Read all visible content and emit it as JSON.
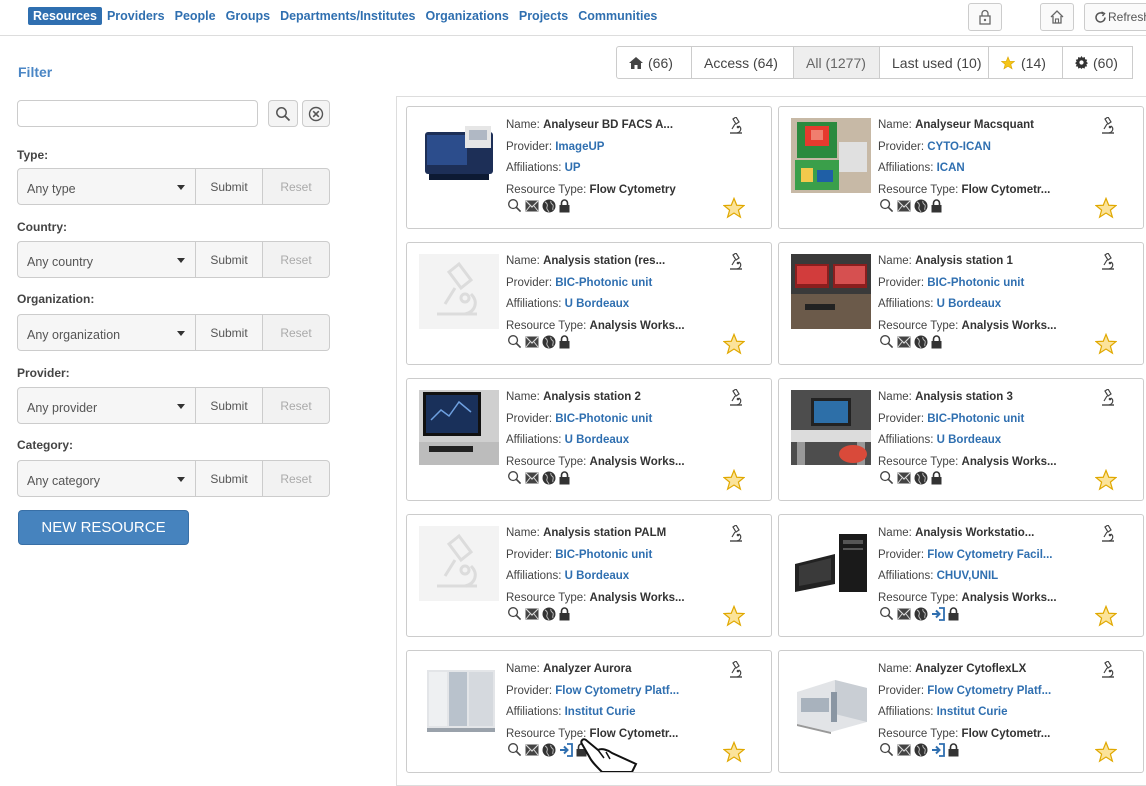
{
  "nav": {
    "links": [
      "Resources",
      "Providers",
      "People",
      "Groups",
      "Departments/Institutes",
      "Organizations",
      "Projects",
      "Communities"
    ],
    "refresh_label": "Refresh"
  },
  "tabs": [
    {
      "label": "(66)",
      "icon": "home-icon"
    },
    {
      "label": "Access (64)"
    },
    {
      "label": "All (1277)"
    },
    {
      "label": "Last used (10)"
    },
    {
      "label": "(14)",
      "icon": "star-icon"
    },
    {
      "label": "(60)",
      "icon": "gear-icon"
    }
  ],
  "filter": {
    "title": "Filter",
    "search_value": "",
    "submit_label": "Submit",
    "reset_label": "Reset",
    "groups": [
      {
        "label": "Type:",
        "value": "Any type"
      },
      {
        "label": "Country:",
        "value": "Any country"
      },
      {
        "label": "Organization:",
        "value": "Any organization"
      },
      {
        "label": "Provider:",
        "value": "Any provider"
      },
      {
        "label": "Category:",
        "value": "Any category"
      }
    ],
    "new_resource_label": "NEW RESOURCE"
  },
  "field_labels": {
    "name": "Name:",
    "provider": "Provider:",
    "affiliations": "Affiliations:",
    "type": "Resource Type:"
  },
  "resources": [
    {
      "name": "Analyseur BD FACS A...",
      "provider": "ImageUP",
      "affiliations": "UP",
      "type": "Flow Cytometry",
      "thumb": "cytometer-dark",
      "login": false
    },
    {
      "name": "Analyseur Macsquant",
      "provider": "CYTO-ICAN",
      "affiliations": "ICAN",
      "type": "Flow Cytometr...",
      "thumb": "lab-machine-green",
      "login": false
    },
    {
      "name": "Analysis station (res...",
      "provider": "BIC-Photonic unit",
      "affiliations": "U Bordeaux",
      "type": "Analysis Works...",
      "thumb": "placeholder-microscope",
      "login": false
    },
    {
      "name": "Analysis station 1",
      "provider": "BIC-Photonic unit",
      "affiliations": "U Bordeaux",
      "type": "Analysis Works...",
      "thumb": "workstation-red",
      "login": false
    },
    {
      "name": "Analysis station 2",
      "provider": "BIC-Photonic unit",
      "affiliations": "U Bordeaux",
      "type": "Analysis Works...",
      "thumb": "workstation-blue",
      "login": false
    },
    {
      "name": "Analysis station 3",
      "provider": "BIC-Photonic unit",
      "affiliations": "U Bordeaux",
      "type": "Analysis Works...",
      "thumb": "workstation-desk",
      "login": false
    },
    {
      "name": "Analysis station PALM",
      "provider": "BIC-Photonic unit",
      "affiliations": "U Bordeaux",
      "type": "Analysis Works...",
      "thumb": "placeholder-microscope",
      "login": false
    },
    {
      "name": "Analysis Workstatio...",
      "provider": "Flow Cytometry Facil...",
      "affiliations": "CHUV,UNIL",
      "type": "Analysis Works...",
      "thumb": "pc-tower",
      "login": true
    },
    {
      "name": "Analyzer Aurora",
      "provider": "Flow Cytometry Platf...",
      "affiliations": "Institut Curie",
      "type": "Flow Cytometr...",
      "thumb": "aurora-white",
      "login": true
    },
    {
      "name": "Analyzer CytoflexLX",
      "provider": "Flow Cytometry Platf...",
      "affiliations": "Institut Curie",
      "type": "Flow Cytometr...",
      "thumb": "cytoflex-white",
      "login": true
    }
  ],
  "colors": {
    "link": "#2f6fb0",
    "accent_button": "#4683be",
    "star": "#f5b800"
  }
}
